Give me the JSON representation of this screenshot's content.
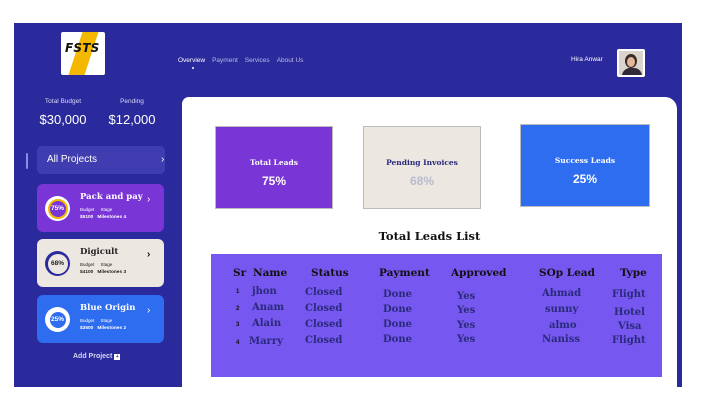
{
  "brand": {
    "logo_text": "FSTS",
    "logo_color": "#f5b800"
  },
  "nav": {
    "items": [
      "Overview",
      "Payment",
      "Services",
      "About Us"
    ],
    "active": "Overview"
  },
  "user": {
    "name": "Hira Anwar"
  },
  "stats": {
    "total_budget_label": "Total Budget",
    "total_budget_value": "$30,000",
    "pending_label": "Pending",
    "pending_value": "$12,000"
  },
  "sidebar": {
    "all_projects_label": "All Projects",
    "add_project_label": "Add Project",
    "projects": [
      {
        "name": "Pack and pay",
        "percent": "75%",
        "budget_label": "Budget",
        "stage_label": "Stage",
        "budget": "$5100",
        "milestone": "Milestones 4"
      },
      {
        "name": "Digicult",
        "percent": "68%",
        "budget_label": "Budget",
        "stage_label": "Stage",
        "budget": "$4100",
        "milestone": "Milestones 3"
      },
      {
        "name": "Blue Origin",
        "percent": "25%",
        "budget_label": "Budget",
        "stage_label": "Stage",
        "budget": "$3500",
        "milestone": "Milestones 2"
      }
    ]
  },
  "kpis": [
    {
      "label": "Total Leads",
      "value": "75%",
      "color": "#7a35d6"
    },
    {
      "label": "Pending Invoices",
      "value": "68%",
      "color": "#ece7e1"
    },
    {
      "label": "Success Leads",
      "value": "25%",
      "color": "#2e6cf0"
    }
  ],
  "leads": {
    "title": "Total Leads List",
    "columns": [
      "Sr",
      "Name",
      "Status",
      "Payment",
      "Approved",
      "SOp Lead",
      "Type"
    ],
    "rows": [
      [
        "1",
        "jhon",
        "Closed",
        "Done",
        "Yes",
        "Ahmad",
        "Flight"
      ],
      [
        "2",
        "Anam",
        "Closed",
        "Done",
        "Yes",
        "sunny",
        "Hotel"
      ],
      [
        "3",
        "Alain",
        "Closed",
        "Done",
        "Yes",
        "almo",
        "Visa"
      ],
      [
        "4",
        "Marry",
        "Closed",
        "Done",
        "Yes",
        "Naniss",
        "Flight"
      ]
    ]
  },
  "colors": {
    "frame": "#2b2a9c",
    "table_bg": "#7657f0"
  }
}
